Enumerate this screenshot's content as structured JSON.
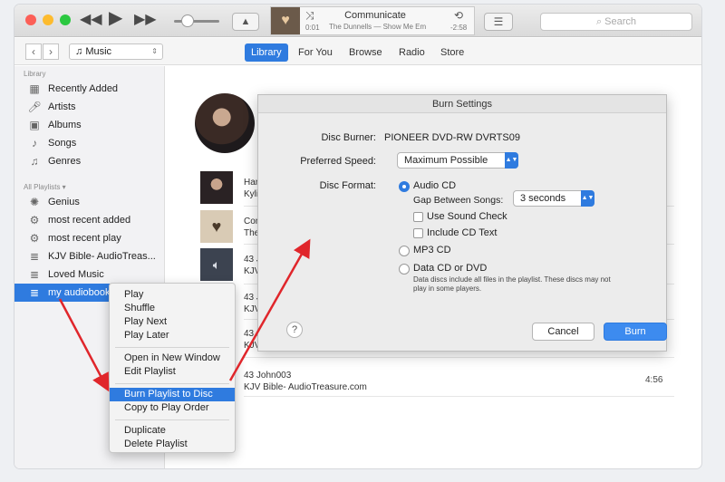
{
  "titlebar": {
    "now_playing_title": "Communicate",
    "now_playing_subtitle": "The Dunnells — Show Me Em",
    "time_elapsed": "0:01",
    "time_remaining": "-2:58",
    "search_placeholder": "Search"
  },
  "navbar": {
    "source": "Music",
    "tabs": [
      {
        "label": "Library"
      },
      {
        "label": "For You"
      },
      {
        "label": "Browse"
      },
      {
        "label": "Radio"
      },
      {
        "label": "Store"
      }
    ]
  },
  "sidebar": {
    "library_header": "Library",
    "library_items": [
      {
        "label": "Recently Added",
        "icon": "grid-icon"
      },
      {
        "label": "Artists",
        "icon": "microphone-icon"
      },
      {
        "label": "Albums",
        "icon": "album-icon"
      },
      {
        "label": "Songs",
        "icon": "note-icon"
      },
      {
        "label": "Genres",
        "icon": "genre-icon"
      }
    ],
    "playlists_header": "All Playlists ▾",
    "playlist_items": [
      {
        "label": "Genius",
        "icon": "genius-icon"
      },
      {
        "label": "most recent added",
        "icon": "gear-icon"
      },
      {
        "label": "most recent play",
        "icon": "gear-icon"
      },
      {
        "label": "KJV Bible- AudioTreas...",
        "icon": "playlist-icon"
      },
      {
        "label": "Loved Music",
        "icon": "playlist-icon"
      },
      {
        "label": "my audiobook",
        "icon": "playlist-icon",
        "selected": true
      }
    ]
  },
  "tracks": [
    {
      "line1": "Hand C",
      "line2": "Kylie M"
    },
    {
      "line1": "Comm",
      "line2": "The D"
    },
    {
      "line1": "43 Joh",
      "line2": "KJV Bi"
    },
    {
      "line1": "43 Joh",
      "line2": "KJV Bi"
    },
    {
      "line1": "43 Joh",
      "line2": "KJV Bi"
    },
    {
      "line1": "43 Joh",
      "line2": "KJV Bi"
    },
    {
      "line1": "43 John003",
      "line2": "KJV Bible- AudioTreasure.com",
      "duration": "4:56"
    }
  ],
  "dialog": {
    "title": "Burn Settings",
    "disc_burner_label": "Disc Burner:",
    "disc_burner_value": "PIONEER DVD-RW  DVRTS09",
    "speed_label": "Preferred Speed:",
    "speed_value": "Maximum Possible",
    "format_label": "Disc Format:",
    "audio_cd": "Audio CD",
    "gap_label": "Gap Between Songs:",
    "gap_value": "3 seconds",
    "sound_check": "Use Sound Check",
    "cd_text": "Include CD Text",
    "mp3_cd": "MP3 CD",
    "data_cd": "Data CD or DVD",
    "data_note": "Data discs include all files in the playlist. These discs may not play in some players.",
    "help": "?",
    "cancel": "Cancel",
    "burn": "Burn"
  },
  "context_menu": {
    "items": [
      "Play",
      "Shuffle",
      "Play Next",
      "Play Later",
      "Open in New Window",
      "Edit Playlist",
      "Burn Playlist to Disc",
      "Copy to Play Order",
      "Duplicate",
      "Delete Playlist"
    ]
  },
  "colors": {
    "accent": "#2f7bdf",
    "arrow": "#e0262b"
  }
}
